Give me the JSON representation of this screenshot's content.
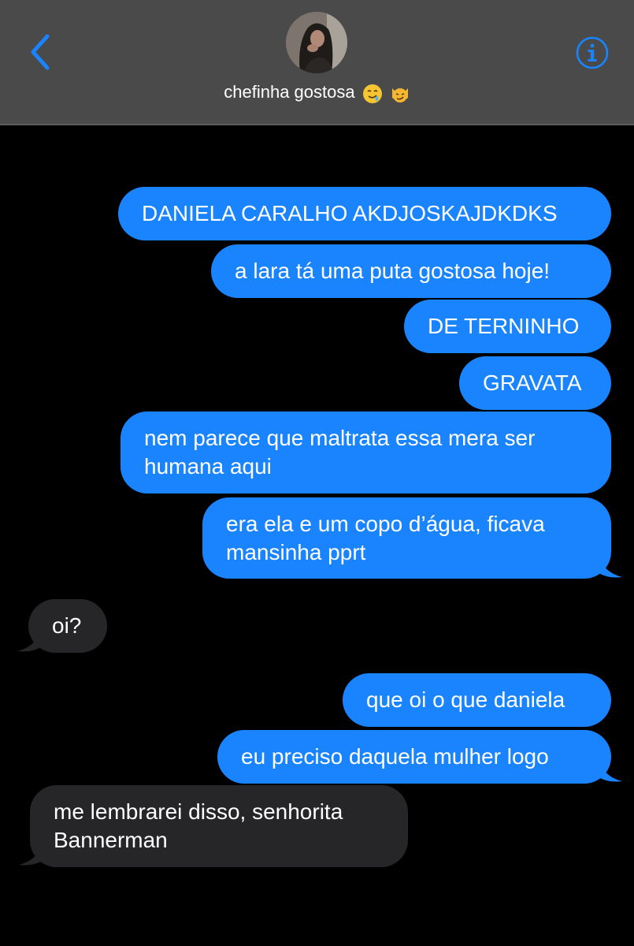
{
  "header": {
    "back_label": "<",
    "contact_name": "chefinha gostosa",
    "emojis": [
      "drooling-face",
      "smirking-cat-face"
    ],
    "info_icon": "info-icon"
  },
  "colors": {
    "header_bg": "#4a4a4a",
    "sent_bubble": "#1a84ff",
    "received_bubble": "#262628",
    "accent": "#1a84ff",
    "background": "#000000"
  },
  "messages": [
    {
      "from": "me",
      "lines": [
        "DANIELA CARALHO AKDJOSKAJDKDKS"
      ]
    },
    {
      "from": "me",
      "lines": [
        "a lara tá uma puta gostosa hoje!"
      ]
    },
    {
      "from": "me",
      "lines": [
        "DE TERNINHO"
      ]
    },
    {
      "from": "me",
      "lines": [
        "GRAVATA"
      ]
    },
    {
      "from": "me",
      "lines": [
        "nem parece que maltrata essa mera ser",
        "humana aqui"
      ]
    },
    {
      "from": "me",
      "lines": [
        "era ela e um copo d’água, ficava",
        "mansinha pprt"
      ]
    },
    {
      "from": "them",
      "lines": [
        "oi?"
      ]
    },
    {
      "from": "me",
      "lines": [
        "que oi o que daniela"
      ]
    },
    {
      "from": "me",
      "lines": [
        "eu preciso daquela mulher logo"
      ]
    },
    {
      "from": "them",
      "lines": [
        "me lembrarei disso, senhorita",
        "Bannerman"
      ]
    }
  ]
}
